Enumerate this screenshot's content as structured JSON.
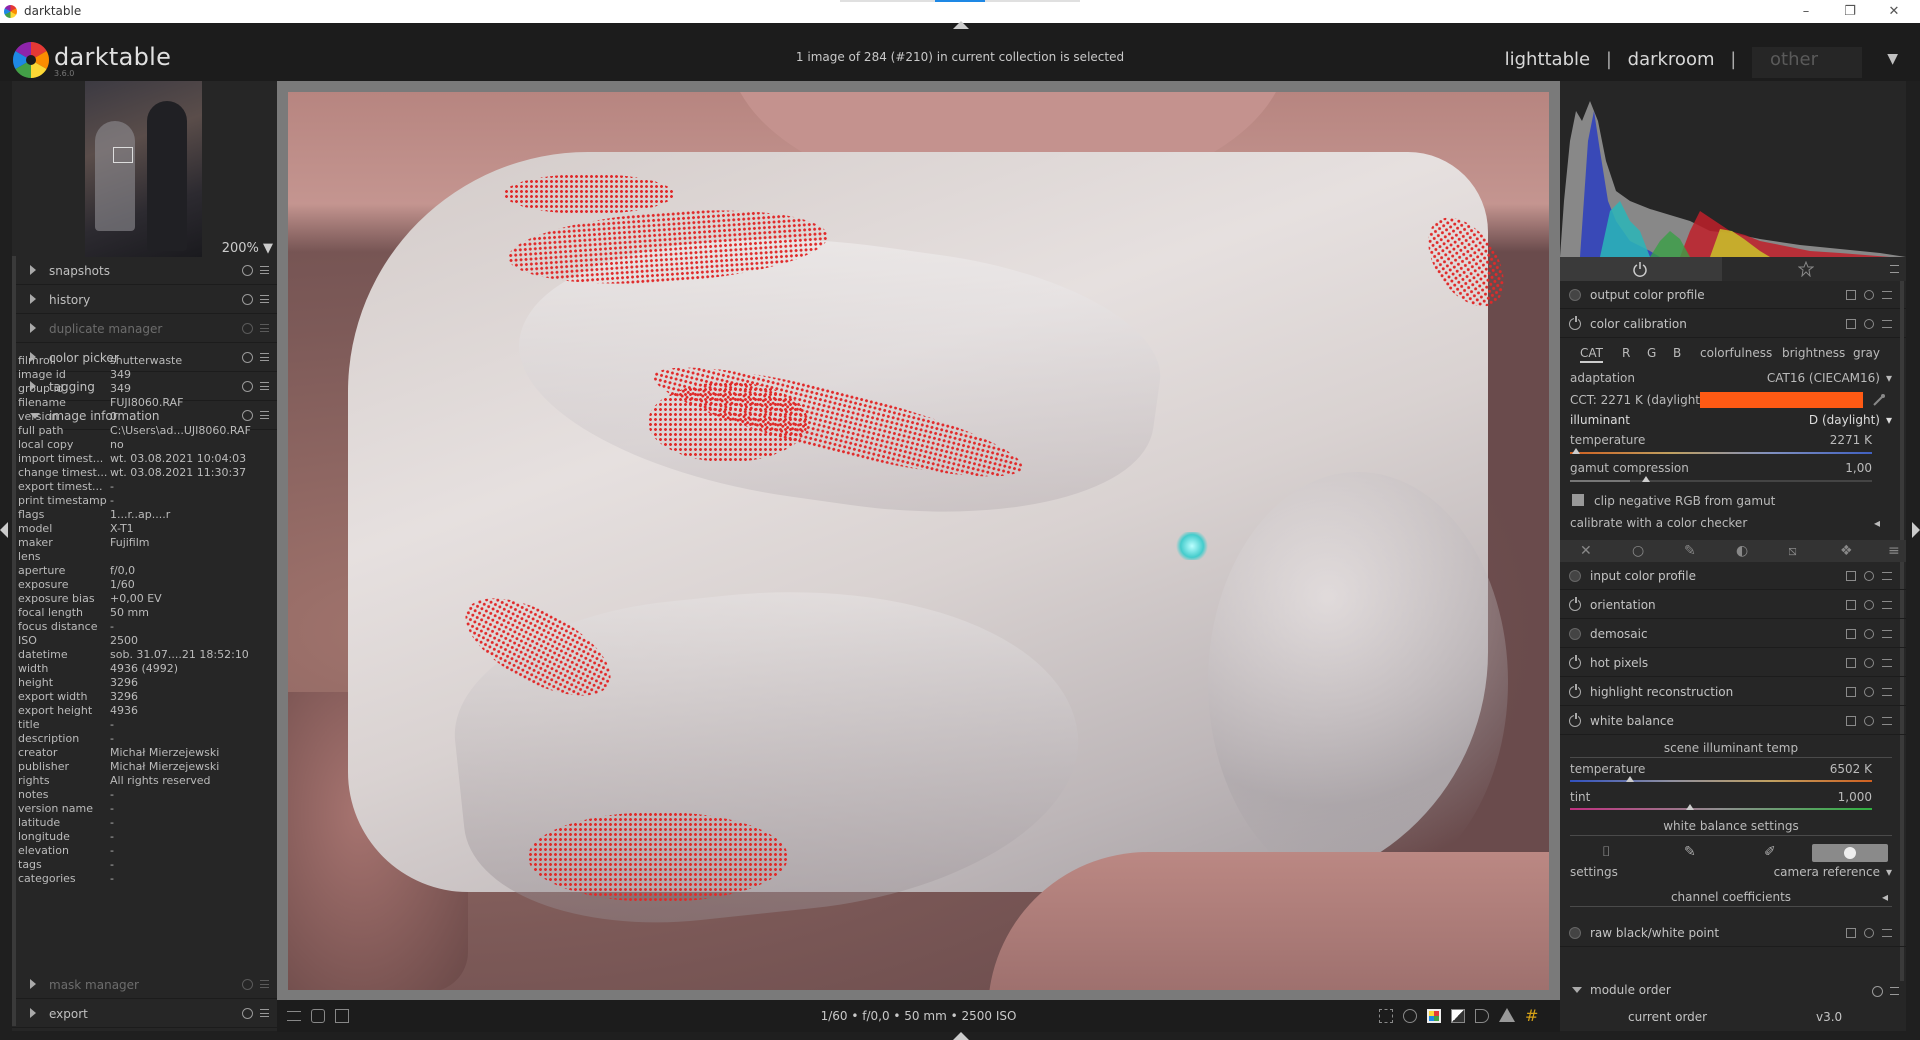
{
  "window": {
    "title": "darktable",
    "minimize_glyph": "–",
    "restore_glyph": "❐",
    "close_glyph": "✕",
    "title_progress_color": "#1e88e5"
  },
  "header": {
    "logo_text": "darktable",
    "version": "3.6.0",
    "status": "1 image of 284 (#210) in current collection is selected",
    "views": {
      "lighttable": "lighttable",
      "sep1": "|",
      "darkroom": "darkroom",
      "sep2": "|",
      "other": "other",
      "dropdown_glyph": "▼"
    }
  },
  "left": {
    "zoom": "200%",
    "zoom_arrow": "▼",
    "modules": [
      {
        "label": "snapshots"
      },
      {
        "label": "history"
      },
      {
        "label": "duplicate manager"
      },
      {
        "label": "color picker"
      },
      {
        "label": "tagging"
      },
      {
        "label": "image information"
      }
    ],
    "bottom_modules": [
      {
        "label": "mask manager"
      },
      {
        "label": "export"
      }
    ],
    "image_info": [
      {
        "k": "filmroll",
        "v": "shutterwaste"
      },
      {
        "k": "image id",
        "v": "349"
      },
      {
        "k": "group id",
        "v": "349"
      },
      {
        "k": "filename",
        "v": "FUJI8060.RAF"
      },
      {
        "k": "version",
        "v": "0"
      },
      {
        "k": "full path",
        "v": "C:\\Users\\ad...UJI8060.RAF"
      },
      {
        "k": "local copy",
        "v": "no"
      },
      {
        "k": "import timest...",
        "v": "wt. 03.08.2021 10:04:03"
      },
      {
        "k": "change timest...",
        "v": "wt. 03.08.2021 11:30:37"
      },
      {
        "k": "export timest...",
        "v": "-"
      },
      {
        "k": "print timestamp",
        "v": "-"
      },
      {
        "k": "flags",
        "v": "1...r..ap....r"
      },
      {
        "k": "model",
        "v": "X-T1"
      },
      {
        "k": "maker",
        "v": "Fujifilm"
      },
      {
        "k": "lens",
        "v": ""
      },
      {
        "k": "aperture",
        "v": "f/0,0"
      },
      {
        "k": "exposure",
        "v": "1/60"
      },
      {
        "k": "exposure bias",
        "v": "+0,00 EV"
      },
      {
        "k": "focal length",
        "v": "50 mm"
      },
      {
        "k": "focus distance",
        "v": "-"
      },
      {
        "k": "ISO",
        "v": "2500"
      },
      {
        "k": "datetime",
        "v": "sob. 31.07....21 18:52:10"
      },
      {
        "k": "width",
        "v": "4936 (4992)"
      },
      {
        "k": "height",
        "v": "3296"
      },
      {
        "k": "export width",
        "v": "3296"
      },
      {
        "k": "export height",
        "v": "4936"
      },
      {
        "k": "title",
        "v": "-"
      },
      {
        "k": "description",
        "v": "-"
      },
      {
        "k": "creator",
        "v": "Michał Mierzejewski"
      },
      {
        "k": "publisher",
        "v": "Michał Mierzejewski"
      },
      {
        "k": "rights",
        "v": "All rights reserved"
      },
      {
        "k": "notes",
        "v": "-"
      },
      {
        "k": "version name",
        "v": "-"
      },
      {
        "k": "latitude",
        "v": "-"
      },
      {
        "k": "longitude",
        "v": "-"
      },
      {
        "k": "elevation",
        "v": "-"
      },
      {
        "k": "tags",
        "v": "-"
      },
      {
        "k": "categories",
        "v": "-"
      }
    ]
  },
  "right": {
    "modules_top": [
      {
        "label": "output color profile"
      },
      {
        "label": "color calibration"
      }
    ],
    "calib_tabs": [
      "CAT",
      "R",
      "G",
      "B",
      "colorfulness",
      "brightness",
      "gray"
    ],
    "adaptation_label": "adaptation",
    "adaptation_value": "CAT16 (CIECAM16)",
    "cct_label": "CCT: 2271 K (daylight)",
    "cct_color": "#ff5a14",
    "illuminant_label": "illuminant",
    "illuminant_value": "D (daylight)",
    "temperature_label": "temperature",
    "temperature_value": "2271 K",
    "gamut_label": "gamut compression",
    "gamut_value": "1,00",
    "clip_label": "clip negative RGB from gamut",
    "checker_label": "calibrate with a color checker",
    "dropdown_glyph": "▾",
    "collapse_glyph": "◂",
    "modules_mid": [
      {
        "label": "input color profile"
      },
      {
        "label": "orientation"
      },
      {
        "label": "demosaic"
      },
      {
        "label": "hot pixels"
      },
      {
        "label": "highlight reconstruction"
      },
      {
        "label": "white balance"
      }
    ],
    "wb": {
      "section": "scene illuminant temp",
      "temperature_label": "temperature",
      "temperature_value": "6502 K",
      "tint_label": "tint",
      "tint_value": "1,000",
      "settings_section": "white balance settings",
      "settings_label": "settings",
      "camera_reference": "camera reference",
      "channel_section": "channel coefficients"
    },
    "raw_module": "raw black/white point",
    "module_order_label": "module order",
    "current_order_label": "current order",
    "current_order_value": "v3.0"
  },
  "bottom": {
    "exif": "1/60 • f/0,0 • 50 mm • 2500 ISO"
  }
}
